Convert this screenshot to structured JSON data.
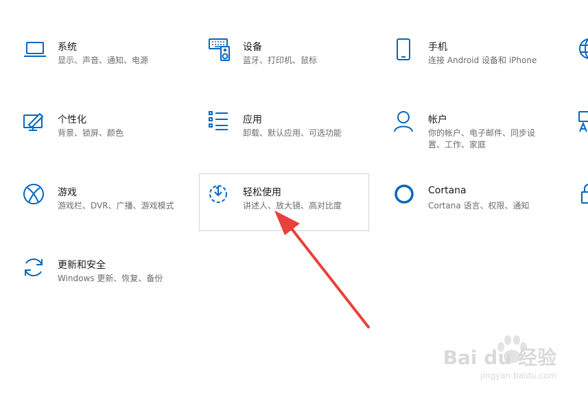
{
  "accent_color": "#0067c0",
  "arrow_color": "#e8403a",
  "tiles": [
    {
      "title": "系统",
      "desc": "显示、声音、通知、电源",
      "icon": "laptop-icon"
    },
    {
      "title": "设备",
      "desc": "蓝牙、打印机、鼠标",
      "icon": "keyboard-speaker-icon"
    },
    {
      "title": "手机",
      "desc": "连接 Android 设备和 iPhone",
      "icon": "phone-icon"
    },
    {
      "title": "个性化",
      "desc": "背景、锁屏、颜色",
      "icon": "paint-monitor-icon"
    },
    {
      "title": "应用",
      "desc": "卸载、默认应用、可选功能",
      "icon": "apps-list-icon"
    },
    {
      "title": "帐户",
      "desc": "你的帐户、电子邮件、同步设置、工作、家庭",
      "icon": "person-icon"
    },
    {
      "title": "游戏",
      "desc": "游戏栏、DVR、广播、游戏模式",
      "icon": "xbox-icon"
    },
    {
      "title": "轻松使用",
      "desc": "讲述人、放大镜、高对比度",
      "icon": "ease-of-access-icon"
    },
    {
      "title": "Cortana",
      "desc": "Cortana 语言、权限、通知",
      "icon": "cortana-icon"
    },
    {
      "title": "更新和安全",
      "desc": "Windows 更新、恢复、备份",
      "icon": "sync-icon"
    }
  ],
  "watermark": {
    "logo": "Bai du 经验",
    "url": "jingyan.baidu.com"
  }
}
